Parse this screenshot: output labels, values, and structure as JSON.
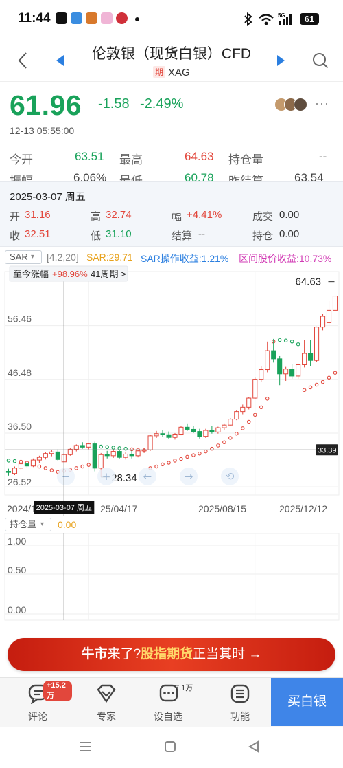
{
  "status_bar": {
    "time": "11:44",
    "battery": "61"
  },
  "header": {
    "title": "伦敦银（现货白银）CFD",
    "futures_tag": "期",
    "symbol": "XAG"
  },
  "quote": {
    "price": "61.96",
    "change": "-1.58",
    "change_pct": "-2.49%",
    "timestamp": "12-13 05:55:00",
    "more": "···"
  },
  "stats": {
    "open_label": "今开",
    "open_value": "63.51",
    "high_label": "最高",
    "high_value": "64.63",
    "oi_label": "持仓量",
    "oi_value": "--",
    "amp_label": "振幅",
    "amp_value": "6.06%",
    "low_label": "最低",
    "low_value": "60.78",
    "prev_settle_label": "昨结算",
    "prev_settle_value": "63.54"
  },
  "popup": {
    "date": "2025-03-07 周五",
    "open_label": "开",
    "open": "31.16",
    "high_label": "高",
    "high": "32.74",
    "amp_label": "幅",
    "amp": "+4.41%",
    "vol_label": "成交",
    "vol": "0.00",
    "close_label": "收",
    "close": "32.51",
    "low_label": "低",
    "low": "31.10",
    "settle_label": "结算",
    "settle": "--",
    "hold_label": "持仓",
    "hold": "0.00"
  },
  "indicator": {
    "name": "SAR",
    "params": "[4,2,20]",
    "sar": "SAR:29.71",
    "sar_return": "SAR操作收益:1.21%",
    "range_return": "区间股价收益:10.73%"
  },
  "chart_info": {
    "since_label": "至今涨幅",
    "since_value": "+98.96%",
    "period": "41周期 >",
    "hover_date": "2025-03-07 周五",
    "current_price_tag": "33.39"
  },
  "chart_data": {
    "type": "candlestick",
    "period": "weekly",
    "y_ticks": [
      "56.46",
      "46.48",
      "36.50",
      "26.52"
    ],
    "x_ticks": [
      "2024/12",
      "25/04/17",
      "2025/08/15",
      "2025/12/12"
    ],
    "max_label": "64.63",
    "min_label": "28.34",
    "ylim": [
      25.0,
      66.5
    ],
    "candles": [
      {
        "o": 29.4,
        "h": 29.9,
        "l": 28.6,
        "c": 29.2
      },
      {
        "o": 29.0,
        "h": 30.3,
        "l": 28.7,
        "c": 30.0
      },
      {
        "o": 30.0,
        "h": 31.2,
        "l": 29.6,
        "c": 30.8
      },
      {
        "o": 30.8,
        "h": 31.4,
        "l": 30.1,
        "c": 30.4
      },
      {
        "o": 30.4,
        "h": 31.8,
        "l": 30.2,
        "c": 31.5
      },
      {
        "o": 31.5,
        "h": 32.3,
        "l": 31.0,
        "c": 32.0
      },
      {
        "o": 32.0,
        "h": 33.0,
        "l": 31.6,
        "c": 32.7
      },
      {
        "o": 32.7,
        "h": 33.4,
        "l": 32.2,
        "c": 33.0
      },
      {
        "o": 33.0,
        "h": 33.5,
        "l": 31.3,
        "c": 31.6
      },
      {
        "o": 31.16,
        "h": 32.74,
        "l": 31.1,
        "c": 32.51
      },
      {
        "o": 32.5,
        "h": 33.8,
        "l": 32.3,
        "c": 33.5
      },
      {
        "o": 33.5,
        "h": 34.4,
        "l": 33.1,
        "c": 34.2
      },
      {
        "o": 34.2,
        "h": 34.8,
        "l": 33.6,
        "c": 33.9
      },
      {
        "o": 33.9,
        "h": 34.6,
        "l": 33.5,
        "c": 34.5
      },
      {
        "o": 34.5,
        "h": 34.9,
        "l": 29.4,
        "c": 30.0
      },
      {
        "o": 30.0,
        "h": 32.8,
        "l": 28.34,
        "c": 32.5
      },
      {
        "o": 32.5,
        "h": 33.2,
        "l": 31.8,
        "c": 32.3
      },
      {
        "o": 32.3,
        "h": 33.5,
        "l": 31.9,
        "c": 33.1
      },
      {
        "o": 33.1,
        "h": 33.4,
        "l": 31.8,
        "c": 32.0
      },
      {
        "o": 32.0,
        "h": 33.0,
        "l": 31.6,
        "c": 32.6
      },
      {
        "o": 32.6,
        "h": 33.5,
        "l": 31.8,
        "c": 32.3
      },
      {
        "o": 32.3,
        "h": 33.4,
        "l": 32.0,
        "c": 33.2
      },
      {
        "o": 33.2,
        "h": 33.8,
        "l": 32.8,
        "c": 33.4
      },
      {
        "o": 33.4,
        "h": 36.2,
        "l": 33.2,
        "c": 36.0
      },
      {
        "o": 36.0,
        "h": 36.9,
        "l": 35.6,
        "c": 36.4
      },
      {
        "o": 36.4,
        "h": 37.1,
        "l": 35.8,
        "c": 36.2
      },
      {
        "o": 36.2,
        "h": 36.8,
        "l": 35.4,
        "c": 35.7
      },
      {
        "o": 35.7,
        "h": 36.5,
        "l": 35.3,
        "c": 36.3
      },
      {
        "o": 36.3,
        "h": 37.8,
        "l": 36.1,
        "c": 37.6
      },
      {
        "o": 37.6,
        "h": 38.3,
        "l": 36.9,
        "c": 37.2
      },
      {
        "o": 37.2,
        "h": 37.8,
        "l": 36.5,
        "c": 36.8
      },
      {
        "o": 36.8,
        "h": 37.3,
        "l": 35.5,
        "c": 35.9
      },
      {
        "o": 35.9,
        "h": 37.3,
        "l": 35.6,
        "c": 37.0
      },
      {
        "o": 37.0,
        "h": 37.8,
        "l": 36.4,
        "c": 36.7
      },
      {
        "o": 36.7,
        "h": 37.7,
        "l": 36.4,
        "c": 37.5
      },
      {
        "o": 37.5,
        "h": 38.3,
        "l": 37.0,
        "c": 38.0
      },
      {
        "o": 38.0,
        "h": 39.3,
        "l": 37.9,
        "c": 39.1
      },
      {
        "o": 39.1,
        "h": 40.7,
        "l": 38.9,
        "c": 40.5
      },
      {
        "o": 40.5,
        "h": 41.8,
        "l": 40.0,
        "c": 41.3
      },
      {
        "o": 41.3,
        "h": 43.2,
        "l": 40.9,
        "c": 43.0
      },
      {
        "o": 43.0,
        "h": 46.8,
        "l": 42.8,
        "c": 46.5
      },
      {
        "o": 46.5,
        "h": 49.0,
        "l": 46.0,
        "c": 48.3
      },
      {
        "o": 48.3,
        "h": 53.5,
        "l": 47.8,
        "c": 51.8
      },
      {
        "o": 51.8,
        "h": 54.0,
        "l": 49.6,
        "c": 50.3
      },
      {
        "o": 50.3,
        "h": 50.8,
        "l": 45.4,
        "c": 47.5
      },
      {
        "o": 47.5,
        "h": 48.8,
        "l": 46.2,
        "c": 48.4
      },
      {
        "o": 48.4,
        "h": 49.3,
        "l": 46.6,
        "c": 47.1
      },
      {
        "o": 47.1,
        "h": 49.4,
        "l": 46.6,
        "c": 49.2
      },
      {
        "o": 49.2,
        "h": 53.8,
        "l": 48.7,
        "c": 51.3
      },
      {
        "o": 51.3,
        "h": 53.8,
        "l": 48.9,
        "c": 50.0
      },
      {
        "o": 50.0,
        "h": 56.3,
        "l": 49.7,
        "c": 56.2
      },
      {
        "o": 56.2,
        "h": 58.7,
        "l": 55.6,
        "c": 58.2
      },
      {
        "o": 57.0,
        "h": 61.0,
        "l": 56.5,
        "c": 59.3
      },
      {
        "o": 59.3,
        "h": 64.63,
        "l": 59.0,
        "c": 61.96
      }
    ],
    "sar_points": [
      31.4,
      31.3,
      31.2,
      31.0,
      30.7,
      30.3,
      30.0,
      29.6,
      29.3,
      29.5,
      29.7,
      30.0,
      30.3,
      30.6,
      34.2,
      34.0,
      33.9,
      33.8,
      33.7,
      33.6,
      33.5,
      33.4,
      33.3,
      30.0,
      30.3,
      30.7,
      31.0,
      31.4,
      31.7,
      32.1,
      32.4,
      32.7,
      33.1,
      33.6,
      34.2,
      34.8,
      35.6,
      36.4,
      37.4,
      38.6,
      39.9,
      41.3,
      42.9,
      53.5,
      53.8,
      53.7,
      53.5,
      53.0,
      44.5,
      45.0,
      45.5,
      46.0,
      46.8,
      47.7
    ],
    "volume_ticks": [
      "1.00",
      "0.50",
      "0.00"
    ],
    "volume_label": "持仓量",
    "volume_value": "0.00"
  },
  "banner": {
    "part1": "牛市",
    "part2": "来了?",
    "part3": "股指期货",
    "part4": "正当其时 →"
  },
  "nav": {
    "comment_label": "评论",
    "comment_badge": "+15.2万",
    "expert_label": "专家",
    "watch_label": "设自选",
    "watch_badge": "7.1万",
    "function_label": "功能",
    "buy_label": "买白银"
  },
  "colors": {
    "up": "#e2473c",
    "down": "#19a25a",
    "accent": "#2b7fe0"
  }
}
